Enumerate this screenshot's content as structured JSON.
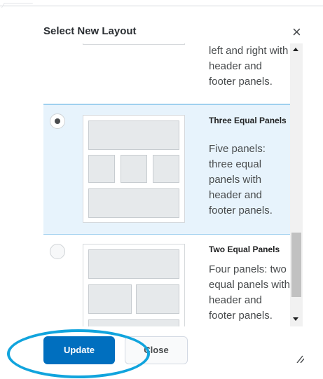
{
  "dialog": {
    "title": "Select New Layout",
    "close_icon": "×"
  },
  "layouts": [
    {
      "title": "",
      "description": "left and right with header and footer panels.",
      "selected": false
    },
    {
      "title": "Three Equal Panels",
      "description": "Five panels: three equal panels with header and footer panels.",
      "selected": true
    },
    {
      "title": "Two Equal Panels",
      "description": "Four panels: two equal panels with header and footer panels.",
      "selected": false
    }
  ],
  "footer": {
    "update_label": "Update",
    "close_label": "Close"
  },
  "colors": {
    "primary": "#006fbf",
    "selected_bg": "#e7f3fc",
    "annotation": "#11a4dd"
  }
}
